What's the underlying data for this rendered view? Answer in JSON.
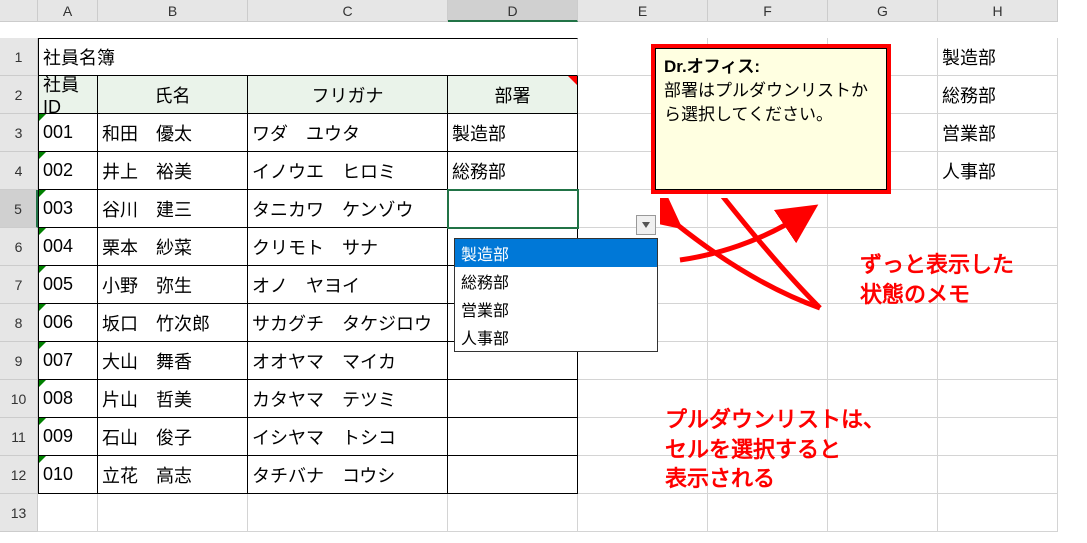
{
  "cols": [
    "A",
    "B",
    "C",
    "D",
    "E",
    "F",
    "G",
    "H"
  ],
  "rows": [
    "1",
    "2",
    "3",
    "4",
    "5",
    "6",
    "7",
    "8",
    "9",
    "10",
    "11",
    "12",
    "13"
  ],
  "title": "社員名簿",
  "headers": {
    "id": "社員ID",
    "name": "氏名",
    "furi": "フリガナ",
    "dept": "部署"
  },
  "data": [
    {
      "id": "001",
      "name": "和田　優太",
      "furi": "ワダ　ユウタ",
      "dept": "製造部"
    },
    {
      "id": "002",
      "name": "井上　裕美",
      "furi": "イノウエ　ヒロミ",
      "dept": "総務部"
    },
    {
      "id": "003",
      "name": "谷川　建三",
      "furi": "タニカワ　ケンゾウ",
      "dept": ""
    },
    {
      "id": "004",
      "name": "栗本　紗菜",
      "furi": "クリモト　サナ",
      "dept": ""
    },
    {
      "id": "005",
      "name": "小野　弥生",
      "furi": "オノ　ヤヨイ",
      "dept": ""
    },
    {
      "id": "006",
      "name": "坂口　竹次郎",
      "furi": "サカグチ　タケジロウ",
      "dept": ""
    },
    {
      "id": "007",
      "name": "大山　舞香",
      "furi": "オオヤマ　マイカ",
      "dept": ""
    },
    {
      "id": "008",
      "name": "片山　哲美",
      "furi": "カタヤマ　テツミ",
      "dept": ""
    },
    {
      "id": "009",
      "name": "石山　俊子",
      "furi": "イシヤマ　トシコ",
      "dept": ""
    },
    {
      "id": "010",
      "name": "立花　高志",
      "furi": "タチバナ　コウシ",
      "dept": ""
    }
  ],
  "lookup": [
    "製造部",
    "総務部",
    "営業部",
    "人事部"
  ],
  "dropdown": {
    "items": [
      "製造部",
      "総務部",
      "営業部",
      "人事部"
    ],
    "selected": 0
  },
  "comment": {
    "author": "Dr.オフィス:",
    "text": "部署はプルダウンリストから選択してください。"
  },
  "annotations": {
    "a1": "ずっと表示した\n状態のメモ",
    "a2": "プルダウンリストは、\nセルを選択すると\n表示される"
  }
}
